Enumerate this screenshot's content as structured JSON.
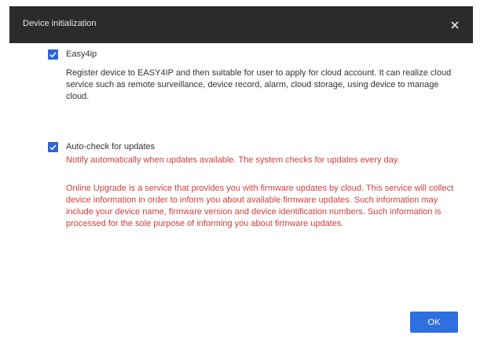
{
  "dialog": {
    "title": "Device initialization",
    "close_glyph": "×",
    "ok_label": "OK"
  },
  "options": {
    "easy4ip": {
      "label": "Easy4ip",
      "checked": true,
      "description": "Register device to EASY4IP and then suitable for user to apply for cloud account. It can realize cloud service such as remote surveillance, device record, alarm, cloud storage, using device to manage cloud."
    },
    "auto_check": {
      "label": "Auto-check for updates",
      "checked": true,
      "notice": "Notify automatically when updates available. The system checks for updates every day.",
      "info": "Online Upgrade is a service that provides you with firmware updates by cloud. This service will collect device information in order to inform you about available firmware updates. Such information may include your device name, firmware version and device identification numbers. Such information is processed for the sole purpose of informing you about firmware updates."
    }
  },
  "colors": {
    "titlebar": "#2b2b2b",
    "accent": "#2f66d6",
    "warning_text": "#d43c3c"
  },
  "icons": {
    "close": "close-icon",
    "check": "checkmark-icon"
  }
}
